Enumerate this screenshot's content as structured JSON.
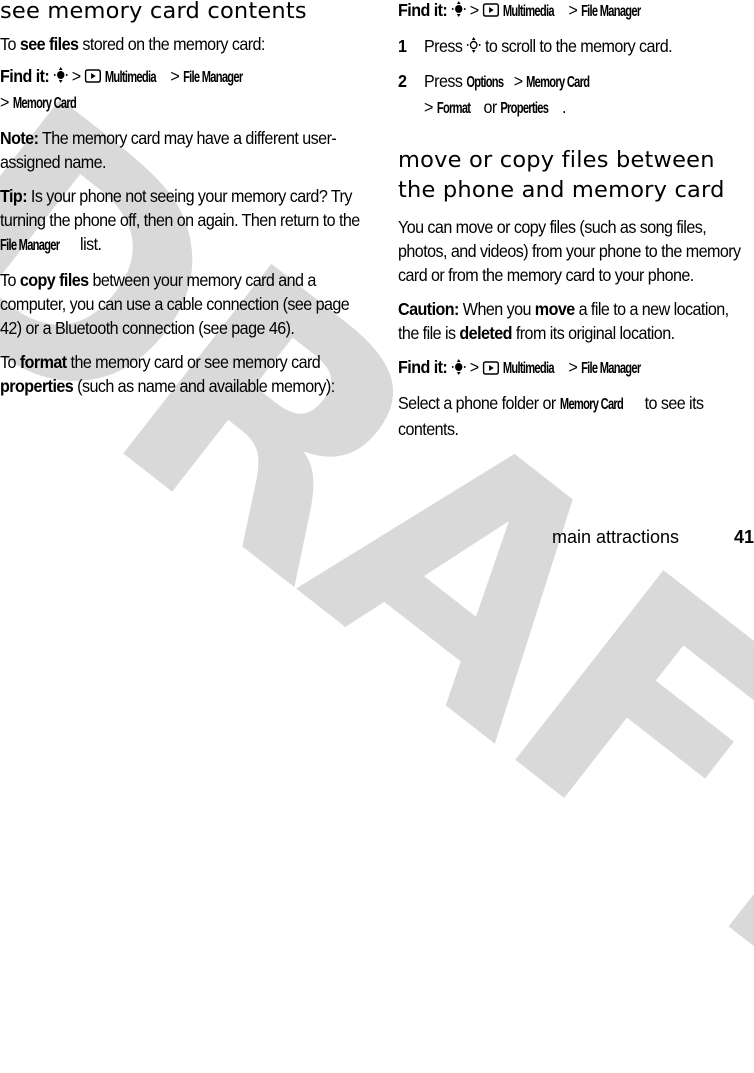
{
  "watermark": "DRAFT",
  "left": {
    "heading": "see memory card contents",
    "intro": {
      "pre": "To ",
      "bold": "see files",
      "post": " stored on the memory card:"
    },
    "find1": {
      "label": "Find it:",
      "sep": ">",
      "multimedia": "Multimedia",
      "file_manager": "File Manager",
      "memory_card": "Memory Card"
    },
    "note": {
      "label": "Note:",
      "text": " The memory card may have a different user-assigned name."
    },
    "tip": {
      "label": "Tip:",
      "text": " Is your phone not seeing your memory card? Try turning the phone off, then on again. Then return to the ",
      "key": "File Manager",
      "post": " list."
    },
    "copy": {
      "pre": "To ",
      "bold": "copy files",
      "post": " between your memory card and a computer, you can use a cable connection (see page 42) or a Bluetooth connection (see page 46)."
    },
    "format": {
      "pre": "To ",
      "bold1": "format",
      "mid": " the memory card or see memory card ",
      "bold2": "properties",
      "post": " (such as name and available memory):"
    }
  },
  "right": {
    "find2": {
      "label": "Find it:",
      "multimedia": "Multimedia",
      "file_manager": "File Manager"
    },
    "steps": [
      {
        "num": "1",
        "pre": "Press ",
        "post": " to scroll to the memory card."
      },
      {
        "num": "2",
        "pre": "Press ",
        "k1": "Options",
        "k2": "Memory Card",
        "k3": "Format",
        "or": " or ",
        "k4": "Properties",
        "end": "."
      }
    ],
    "heading": "move or copy files between the phone and memory card",
    "body": "You can move or copy files (such as song files, photos, and videos) from your phone to the memory card or from the memory card to your phone.",
    "caution": {
      "label": "Caution:",
      "t1": " When you ",
      "b1": "move",
      "t2": " a file to a new location, the file is ",
      "b2": "deleted",
      "t3": " from its original location."
    },
    "find3": {
      "label": "Find it:",
      "multimedia": "Multimedia",
      "file_manager": "File Manager"
    },
    "select": {
      "pre": "Select a phone folder or ",
      "key": "Memory Card",
      "post": " to see its contents."
    }
  },
  "footer": {
    "section": "main attractions",
    "page": "41"
  }
}
